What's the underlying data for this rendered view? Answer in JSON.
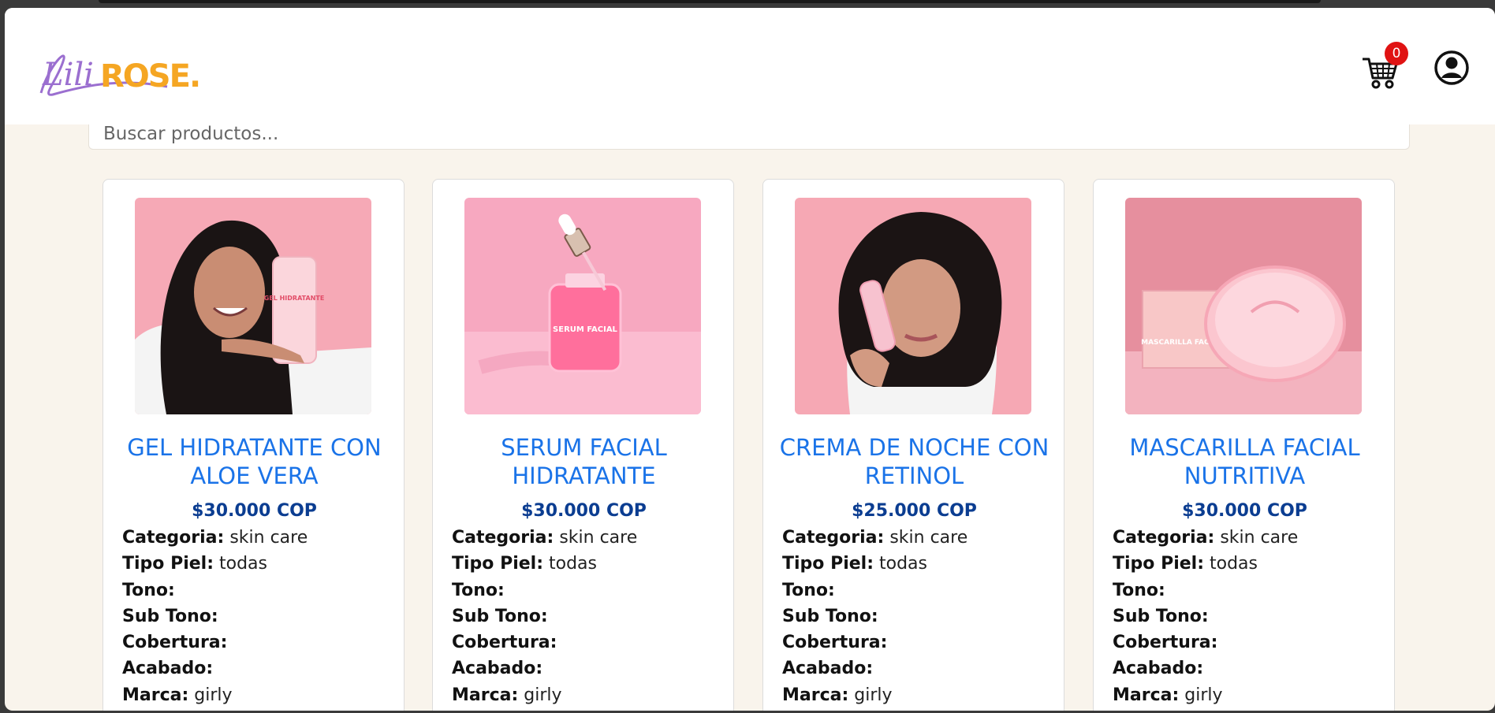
{
  "header": {
    "logo_text_script": "Lili",
    "logo_text_bold": "ROSE.",
    "cart_count": "0"
  },
  "search": {
    "placeholder": "Buscar productos..."
  },
  "attr_labels": {
    "categoria": "Categoria:",
    "tipo_piel": "Tipo Piel:",
    "tono": "Tono:",
    "sub_tono": "Sub Tono:",
    "cobertura": "Cobertura:",
    "acabado": "Acabado:",
    "marca": "Marca:"
  },
  "products": [
    {
      "name": "GEL HIDRATANTE CON ALOE VERA",
      "price": "$30.000 COP",
      "categoria": "skin care",
      "tipo_piel": "todas",
      "tono": "",
      "sub_tono": "",
      "cobertura": "",
      "acabado": "",
      "marca": "girly",
      "image_label": "GEL HIDRATANTE"
    },
    {
      "name": "SERUM FACIAL HIDRATANTE",
      "price": "$30.000 COP",
      "categoria": "skin care",
      "tipo_piel": "todas",
      "tono": "",
      "sub_tono": "",
      "cobertura": "",
      "acabado": "",
      "marca": "girly",
      "image_label": "SERUM FACIAL"
    },
    {
      "name": "CREMA DE NOCHE CON RETINOL",
      "price": "$25.000 COP",
      "categoria": "skin care",
      "tipo_piel": "todas",
      "tono": "",
      "sub_tono": "",
      "cobertura": "",
      "acabado": "",
      "marca": "girly",
      "image_label": ""
    },
    {
      "name": "MASCARILLA FACIAL NUTRITIVA",
      "price": "$30.000 COP",
      "categoria": "skin care",
      "tipo_piel": "todas",
      "tono": "",
      "sub_tono": "",
      "cobertura": "",
      "acabado": "",
      "marca": "girly",
      "image_label": "MASCARILLA FACIAL NUTRITIVA"
    }
  ],
  "colors": {
    "product_name": "#1a73e8",
    "price": "#0b3d91",
    "badge": "#e01313",
    "logo_purple": "#9b6fd0",
    "logo_orange": "#f5a623",
    "page_bg": "#f9f4ec"
  }
}
